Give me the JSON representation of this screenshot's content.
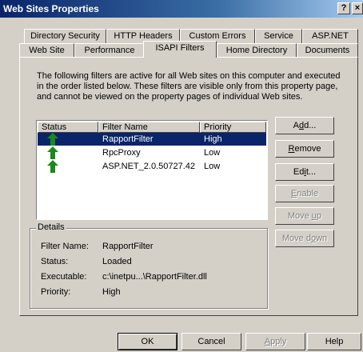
{
  "window": {
    "title": "Web Sites Properties",
    "help_glyph": "?",
    "close_glyph": "×"
  },
  "tabs_row1": [
    {
      "label": "Directory Security"
    },
    {
      "label": "HTTP Headers"
    },
    {
      "label": "Custom Errors"
    },
    {
      "label": "Service"
    },
    {
      "label": "ASP.NET"
    }
  ],
  "tabs_row2": [
    {
      "label": "Web Site"
    },
    {
      "label": "Performance"
    },
    {
      "label": "ISAPI Filters",
      "active": true
    },
    {
      "label": "Home Directory"
    },
    {
      "label": "Documents"
    }
  ],
  "description": "The following filters are active for all Web sites on this computer and executed in the order listed below. These filters are visible only from this property page, and cannot be viewed on the property pages of individual Web sites.",
  "filter_list": {
    "columns": [
      "Status",
      "Filter Name",
      "Priority"
    ],
    "rows": [
      {
        "name": "RapportFilter",
        "priority": "High",
        "status_icon": "green-up-arrow-icon",
        "selected": true
      },
      {
        "name": "RpcProxy",
        "priority": "Low",
        "status_icon": "green-up-arrow-icon",
        "selected": false
      },
      {
        "name": "ASP.NET_2.0.50727.42",
        "priority": "Low",
        "status_icon": "green-up-arrow-icon",
        "selected": false
      }
    ]
  },
  "side_buttons": {
    "add": {
      "pre": "A",
      "u": "d",
      "post": "d..."
    },
    "remove": {
      "pre": "",
      "u": "R",
      "post": "emove"
    },
    "edit": {
      "pre": "Ed",
      "u": "i",
      "post": "t..."
    },
    "enable": {
      "pre": "",
      "u": "E",
      "post": "nable"
    },
    "move_up": {
      "pre": "Move ",
      "u": "u",
      "post": "p"
    },
    "move_down": {
      "pre": "Move d",
      "u": "o",
      "post": "wn"
    }
  },
  "details": {
    "legend": "Details",
    "filter_name_label": "Filter Name:",
    "filter_name_value": "RapportFilter",
    "status_label": "Status:",
    "status_value": "Loaded",
    "executable_label": "Executable:",
    "executable_value": "c:\\inetpu...\\RapportFilter.dll",
    "priority_label": "Priority:",
    "priority_value": "High"
  },
  "bottom_buttons": {
    "ok": "OK",
    "cancel": "Cancel",
    "apply_pre": "",
    "apply_u": "A",
    "apply_post": "pply",
    "help": "Help"
  },
  "colors": {
    "dialog_bg": "#d4d0c8",
    "selection": "#0a246a",
    "status_arrow": "#1a8a1a"
  }
}
